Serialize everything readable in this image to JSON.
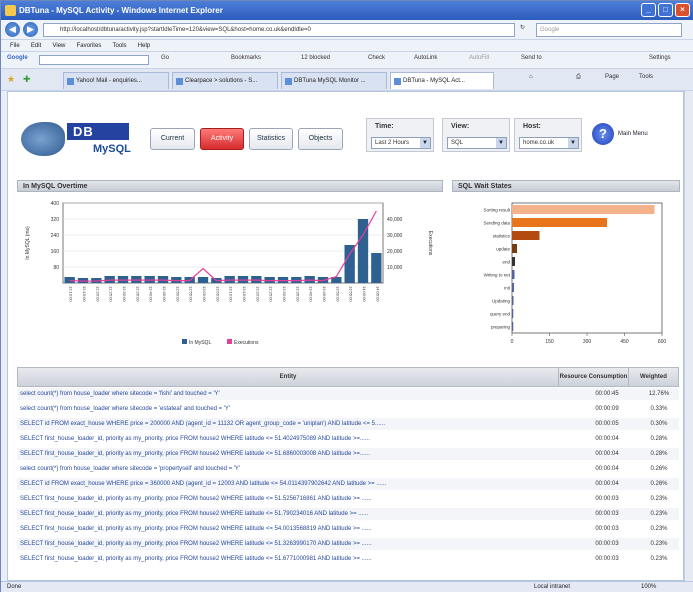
{
  "window": {
    "title": "DBTuna - MySQL Activity - Windows Internet Explorer"
  },
  "address": {
    "url": "http://localhost/dbtuna/activity.jsp?startIdleTime=120&view=SQL&host=home.co.uk&endIdle=0",
    "search_placeholder": "Google"
  },
  "menu": {
    "items": [
      "File",
      "Edit",
      "View",
      "Favorites",
      "Tools",
      "Help"
    ]
  },
  "google_bar": {
    "label": "Google",
    "go": "Go",
    "bookmarks": "Bookmarks",
    "blocked": "12 blocked",
    "check": "Check",
    "autolink": "AutoLink",
    "autofill": "AutoFill",
    "send": "Send to",
    "settings": "Settings"
  },
  "tabs": [
    {
      "label": "Yahoo! Mail - enquiries..."
    },
    {
      "label": "Clearpace > solutions - S..."
    },
    {
      "label": "DBTuna MySQL Monitor ..."
    },
    {
      "label": "DBTuna - MySQL Act..."
    }
  ],
  "tools": {
    "page": "Page",
    "tools": "Tools"
  },
  "logo": {
    "db": "DB Tuna",
    "mysql": "MySQL"
  },
  "nav": {
    "current": "Current",
    "activity": "Activity",
    "statistics": "Statistics",
    "objects": "Objects"
  },
  "filters": {
    "time_label": "Time:",
    "time_value": "Last 2 Hours",
    "view_label": "View:",
    "view_value": "SQL",
    "host_label": "Host:",
    "host_value": "home.co.uk"
  },
  "help": {
    "symbol": "?",
    "label": "Main Menu"
  },
  "panels": {
    "overtime": "In MySQL Overtime",
    "wait": "SQL Wait States"
  },
  "chart_data": [
    {
      "type": "bar",
      "title": "In MySQL Overtime",
      "ylabel": "In MySQL (ms)",
      "y2label": "Executions",
      "ylim": [
        0,
        400
      ],
      "y2lim": [
        0,
        50000
      ],
      "yticks": [
        80,
        160,
        240,
        320,
        400
      ],
      "y2ticks": [
        "10,000",
        "20,000",
        "30,000",
        "40,000"
      ],
      "categories": [
        "12:10:00",
        "12:15:00",
        "12:20:00",
        "12:25:00",
        "12:30:00",
        "12:35:00",
        "12:40:00",
        "12:45:00",
        "12:50:00",
        "12:55:00",
        "13:00:00",
        "13:05:00",
        "13:10:00",
        "13:15:00",
        "13:20:00",
        "13:25:00",
        "13:30:00",
        "13:35:00",
        "13:40:00",
        "13:45:00",
        "13:50:00",
        "13:55:00",
        "14:00:00",
        "14:05:00"
      ],
      "series": [
        {
          "name": "In MySQL",
          "values": [
            30,
            25,
            25,
            35,
            35,
            35,
            35,
            35,
            30,
            30,
            30,
            25,
            35,
            35,
            35,
            30,
            30,
            30,
            35,
            30,
            30,
            190,
            320,
            150
          ]
        },
        {
          "name": "Executions",
          "values": [
            1500,
            1200,
            1200,
            1800,
            1800,
            1800,
            1800,
            1800,
            1500,
            1500,
            9000,
            1500,
            1800,
            1800,
            1800,
            1500,
            1500,
            1500,
            1800,
            1500,
            4000,
            18000,
            30000,
            45000
          ]
        }
      ],
      "legend": [
        "In MySQL",
        "Executions"
      ]
    },
    {
      "type": "bar",
      "title": "SQL Wait States",
      "orientation": "horizontal",
      "categories": [
        "Sorting result",
        "Sending data",
        "statistics",
        "update",
        "end",
        "Writing to net",
        "init",
        "Updating",
        "query end",
        "preparing"
      ],
      "values": [
        570,
        380,
        110,
        20,
        12,
        10,
        8,
        6,
        5,
        5
      ],
      "xticks": [
        0,
        150,
        300,
        450,
        600
      ],
      "xlim": [
        0,
        600
      ]
    }
  ],
  "table": {
    "headers": {
      "entity": "Entity",
      "resource": "Resource Consumption",
      "weighted": "Weighted"
    },
    "rows": [
      {
        "q": "select count(*) from house_loader where sitecode = 'fishi' and touched = 'Y'",
        "t": "00:00:45",
        "p": "12.76%"
      },
      {
        "q": "select count(*) from house_loader where sitecode = 'estateal' and touched = 'Y'",
        "t": "00:00:09",
        "p": "0.33%"
      },
      {
        "q": "SELECT id FROM exact_house WHERE price = 200000 AND (agent_id = 11132 OR agent_group_code = 'uniplan') AND latitude <= 5......",
        "t": "00:00:05",
        "p": "0.30%"
      },
      {
        "q": "SELECT first_house_loader_id, priority as my_priority, price FROM house2 WHERE latitude <= 51.4024975089 AND latitude >=......",
        "t": "00:00:04",
        "p": "0.28%"
      },
      {
        "q": "SELECT first_house_loader_id, priority as my_priority, price FROM house2 WHERE latitude <= 51.6860003008 AND latitude >=......",
        "t": "00:00:04",
        "p": "0.28%"
      },
      {
        "q": "select count(*) from house_loader where sitecode = 'propertysell' and touched = 'Y'",
        "t": "00:00:04",
        "p": "0.26%"
      },
      {
        "q": "SELECT id FROM exact_house WHERE price = 360000 AND (agent_id = 12003 AND latitude <= 54.0114397902642 AND latitude >= ......",
        "t": "00:00:04",
        "p": "0.26%"
      },
      {
        "q": "SELECT first_house_loader_id, priority as my_priority, price FROM house2 WHERE latitude <= 51.5256716861 AND latitude >= ......",
        "t": "00:00:03",
        "p": "0.23%"
      },
      {
        "q": "SELECT first_house_loader_id, priority as my_priority, price FROM house2 WHERE latitude <= 51.790234016 AND latitude >= ......",
        "t": "00:00:03",
        "p": "0.23%"
      },
      {
        "q": "SELECT first_house_loader_id, priority as my_priority, price FROM house2 WHERE latitude <= 54.0013568819 AND latitude >= ......",
        "t": "00:00:03",
        "p": "0.23%"
      },
      {
        "q": "SELECT first_house_loader_id, priority as my_priority, price FROM house2 WHERE latitude <= 51.3263990170 AND latitude >= ......",
        "t": "00:00:03",
        "p": "0.23%"
      },
      {
        "q": "SELECT first_house_loader_id, priority as my_priority, price FROM house2 WHERE latitude <= 51.6771000981 AND latitude >= ......",
        "t": "00:00:03",
        "p": "0.23%"
      }
    ]
  },
  "status": {
    "left": "Done",
    "zone": "Local intranet",
    "zoom": "100%"
  },
  "colors": {
    "bar": "#2f6190",
    "line": "#e63d9a",
    "wait_top": "#f4b28a",
    "wait_mid": "#e8741c",
    "wait_low": "#b34a10",
    "active_tab": "#d62b2b"
  }
}
